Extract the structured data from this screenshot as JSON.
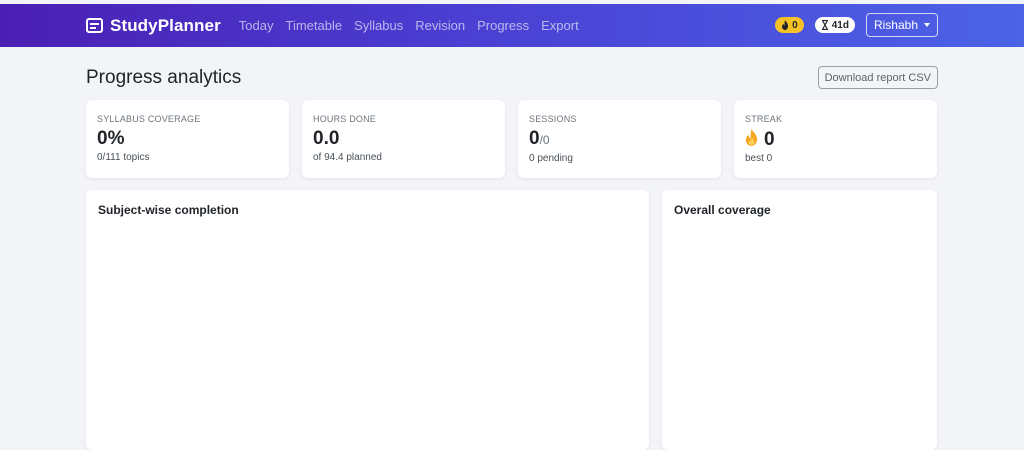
{
  "app": {
    "name": "StudyPlanner"
  },
  "nav": [
    {
      "label": "Today"
    },
    {
      "label": "Timetable"
    },
    {
      "label": "Syllabus"
    },
    {
      "label": "Revision"
    },
    {
      "label": "Progress"
    },
    {
      "label": "Export"
    }
  ],
  "header_right": {
    "streak_badge": "0",
    "days_badge": "41d",
    "user": "Rishabh"
  },
  "page": {
    "title": "Progress analytics",
    "download_label": "Download report CSV"
  },
  "stats": [
    {
      "label": "SYLLABUS COVERAGE",
      "value": "0%",
      "sub": "0/111 topics"
    },
    {
      "label": "HOURS DONE",
      "value": "0.0",
      "sub": "of 94.4 planned"
    },
    {
      "label": "SESSIONS",
      "value": "0",
      "value_suffix": "/0",
      "sub": "0 pending"
    },
    {
      "label": "STREAK",
      "value": "0",
      "sub": "best 0"
    }
  ],
  "panels": {
    "subject": "Subject-wise completion",
    "overall": "Overall coverage"
  },
  "icons": {
    "brand": "calendar-icon",
    "streak": "flame-icon",
    "days": "hourglass-icon"
  },
  "colors": {
    "header_start": "#4b1fb4",
    "header_end": "#4c63e6",
    "streak_badge": "#f5c127",
    "flame": "#f5a623"
  }
}
